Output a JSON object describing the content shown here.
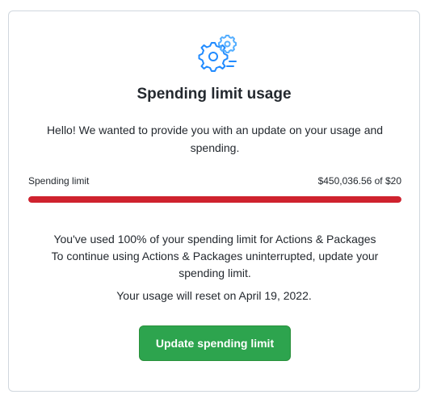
{
  "card": {
    "icon": "gears-icon",
    "title": "Spending limit usage",
    "intro": "Hello! We wanted to provide you with an update on your usage and spending.",
    "limit": {
      "label": "Spending limit",
      "value": "$450,036.56 of $20",
      "progress_percent": 100
    },
    "usage_line1": "You've used 100% of your spending limit for Actions & Packages",
    "usage_line2": "To continue using Actions & Packages uninterrupted, update your spending limit.",
    "reset": "Your usage will reset on April 19, 2022.",
    "button_label": "Update spending limit"
  },
  "colors": {
    "accent_blue": "#218bff",
    "progress_red": "#cf222e",
    "button_green": "#2da44e"
  }
}
